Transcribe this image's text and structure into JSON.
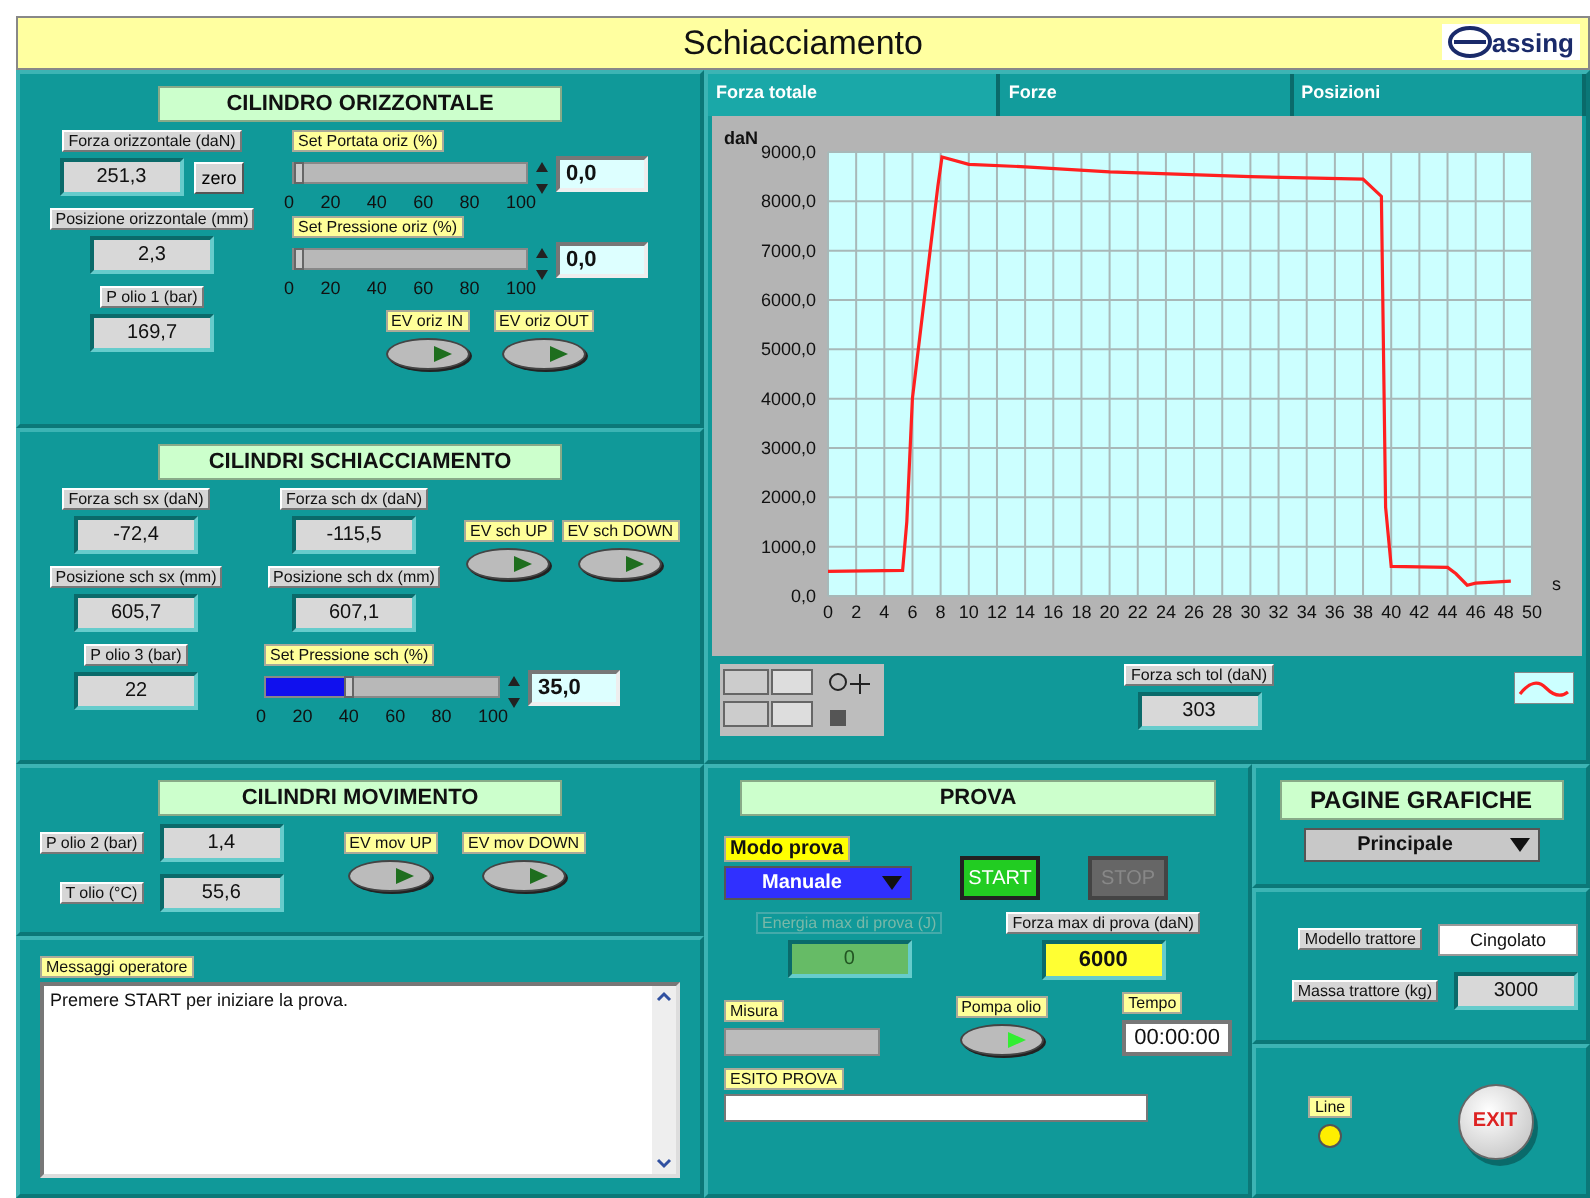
{
  "title": "Schiacciamento",
  "logo": "assing",
  "cilindro_orizzontale": {
    "heading": "CILINDRO ORIZZONTALE",
    "readouts": [
      {
        "label": "Forza orizzontale (daN)",
        "value": "251,3",
        "button": "zero"
      },
      {
        "label": "Posizione orizzontale (mm)",
        "value": "2,3"
      },
      {
        "label": "P olio 1 (bar)",
        "value": "169,7"
      }
    ],
    "sliders": [
      {
        "label": "Set Portata oriz  (%)",
        "level": 0,
        "value": "0,0",
        "ticks": [
          "0",
          "20",
          "40",
          "60",
          "80",
          "100"
        ]
      },
      {
        "label": "Set Pressione oriz  (%)",
        "level": 0,
        "value": "0,0",
        "ticks": [
          "0",
          "20",
          "40",
          "60",
          "80",
          "100"
        ]
      }
    ],
    "switches": [
      {
        "label": "EV oriz IN"
      },
      {
        "label": "EV oriz OUT"
      }
    ]
  },
  "cilindri_schiacciamento": {
    "heading": "CILINDRI SCHIACCIAMENTO",
    "readouts": [
      {
        "label": "Forza sch sx (daN)",
        "value": "-72,4"
      },
      {
        "label": "Forza sch dx (daN)",
        "value": "-115,5"
      },
      {
        "label": "Posizione sch sx (mm)",
        "value": "605,7"
      },
      {
        "label": "Posizione sch dx (mm)",
        "value": "607,1"
      },
      {
        "label": "P olio 3 (bar)",
        "value": "22"
      }
    ],
    "switches": [
      {
        "label": "EV sch UP"
      },
      {
        "label": "EV sch DOWN"
      }
    ],
    "slider": {
      "label": "Set Pressione sch  (%)",
      "level": 0.35,
      "value": "35,0",
      "ticks": [
        "0",
        "20",
        "40",
        "60",
        "80",
        "100"
      ]
    }
  },
  "cilindri_movimento": {
    "heading": "CILINDRI MOVIMENTO",
    "readouts": [
      {
        "label": "P olio 2 (bar)",
        "value": "1,4"
      },
      {
        "label": "T olio (°C)",
        "value": "55,6"
      }
    ],
    "switches": [
      {
        "label": "EV mov UP"
      },
      {
        "label": "EV mov DOWN"
      }
    ]
  },
  "messaggi": {
    "label": "Messaggi operatore",
    "text": "Premere START per iniziare la prova."
  },
  "graph": {
    "tabs": [
      {
        "label": "Forza totale",
        "selected": true
      },
      {
        "label": "Forze",
        "selected": false
      },
      {
        "label": "Posizioni",
        "selected": false
      }
    ],
    "chart_data": {
      "type": "line",
      "grid": true,
      "ylabel": "daN",
      "xlabel": "s",
      "xlim": [
        0,
        50
      ],
      "ylim": [
        0,
        9000
      ],
      "xticks": [
        0,
        2,
        4,
        6,
        8,
        10,
        12,
        14,
        16,
        18,
        20,
        22,
        24,
        26,
        28,
        30,
        32,
        34,
        36,
        38,
        40,
        42,
        44,
        46,
        48,
        50
      ],
      "yticks": [
        {
          "value": 0,
          "label": "0,0"
        },
        {
          "value": 1000,
          "label": "1000,0"
        },
        {
          "value": 2000,
          "label": "2000,0"
        },
        {
          "value": 3000,
          "label": "3000,0"
        },
        {
          "value": 4000,
          "label": "4000,0"
        },
        {
          "value": 5000,
          "label": "5000,0"
        },
        {
          "value": 6000,
          "label": "6000,0"
        },
        {
          "value": 7000,
          "label": "7000,0"
        },
        {
          "value": 8000,
          "label": "8000,0"
        },
        {
          "value": 9000,
          "label": "9000,0"
        }
      ],
      "x": [
        0,
        5.3,
        5.6,
        6,
        7.8,
        8.1,
        10,
        14,
        20,
        30,
        38,
        39.3,
        39.6,
        40,
        44,
        44.6,
        45.4,
        46,
        48.5
      ],
      "series": [
        {
          "color": "#ff2020",
          "values": [
            500,
            520,
            1500,
            4000,
            8300,
            8900,
            8750,
            8700,
            8600,
            8500,
            8450,
            8100,
            1800,
            600,
            580,
            450,
            220,
            260,
            300
          ]
        }
      ]
    },
    "readout": {
      "label": "Forza sch tol (daN)",
      "value": "303"
    }
  },
  "prova": {
    "heading": "PROVA",
    "mode_label": "Modo prova",
    "mode": "Manuale",
    "start": {
      "label": "START",
      "disabled": false
    },
    "stop": {
      "label": "STOP",
      "disabled": true
    },
    "energia": {
      "label": "Energia max di prova (J)",
      "value": "0",
      "disabled": true
    },
    "forza": {
      "label": "Forza max di prova (daN)",
      "value": "6000"
    },
    "misura": {
      "label": "Misura"
    },
    "pompa": {
      "label": "Pompa olio",
      "on": true
    },
    "tempo": {
      "label": "Tempo",
      "value": "00:00:00"
    },
    "esito": {
      "label": "ESITO PROVA"
    }
  },
  "pagine": {
    "heading": "PAGINE GRAFICHE",
    "value": "Principale"
  },
  "trattore": {
    "model_label": "Modello trattore",
    "model": "Cingolato",
    "mass_label": "Massa trattore (kg)",
    "mass": "3000"
  },
  "line": {
    "label": "Line",
    "on": true
  },
  "exit": "EXIT"
}
